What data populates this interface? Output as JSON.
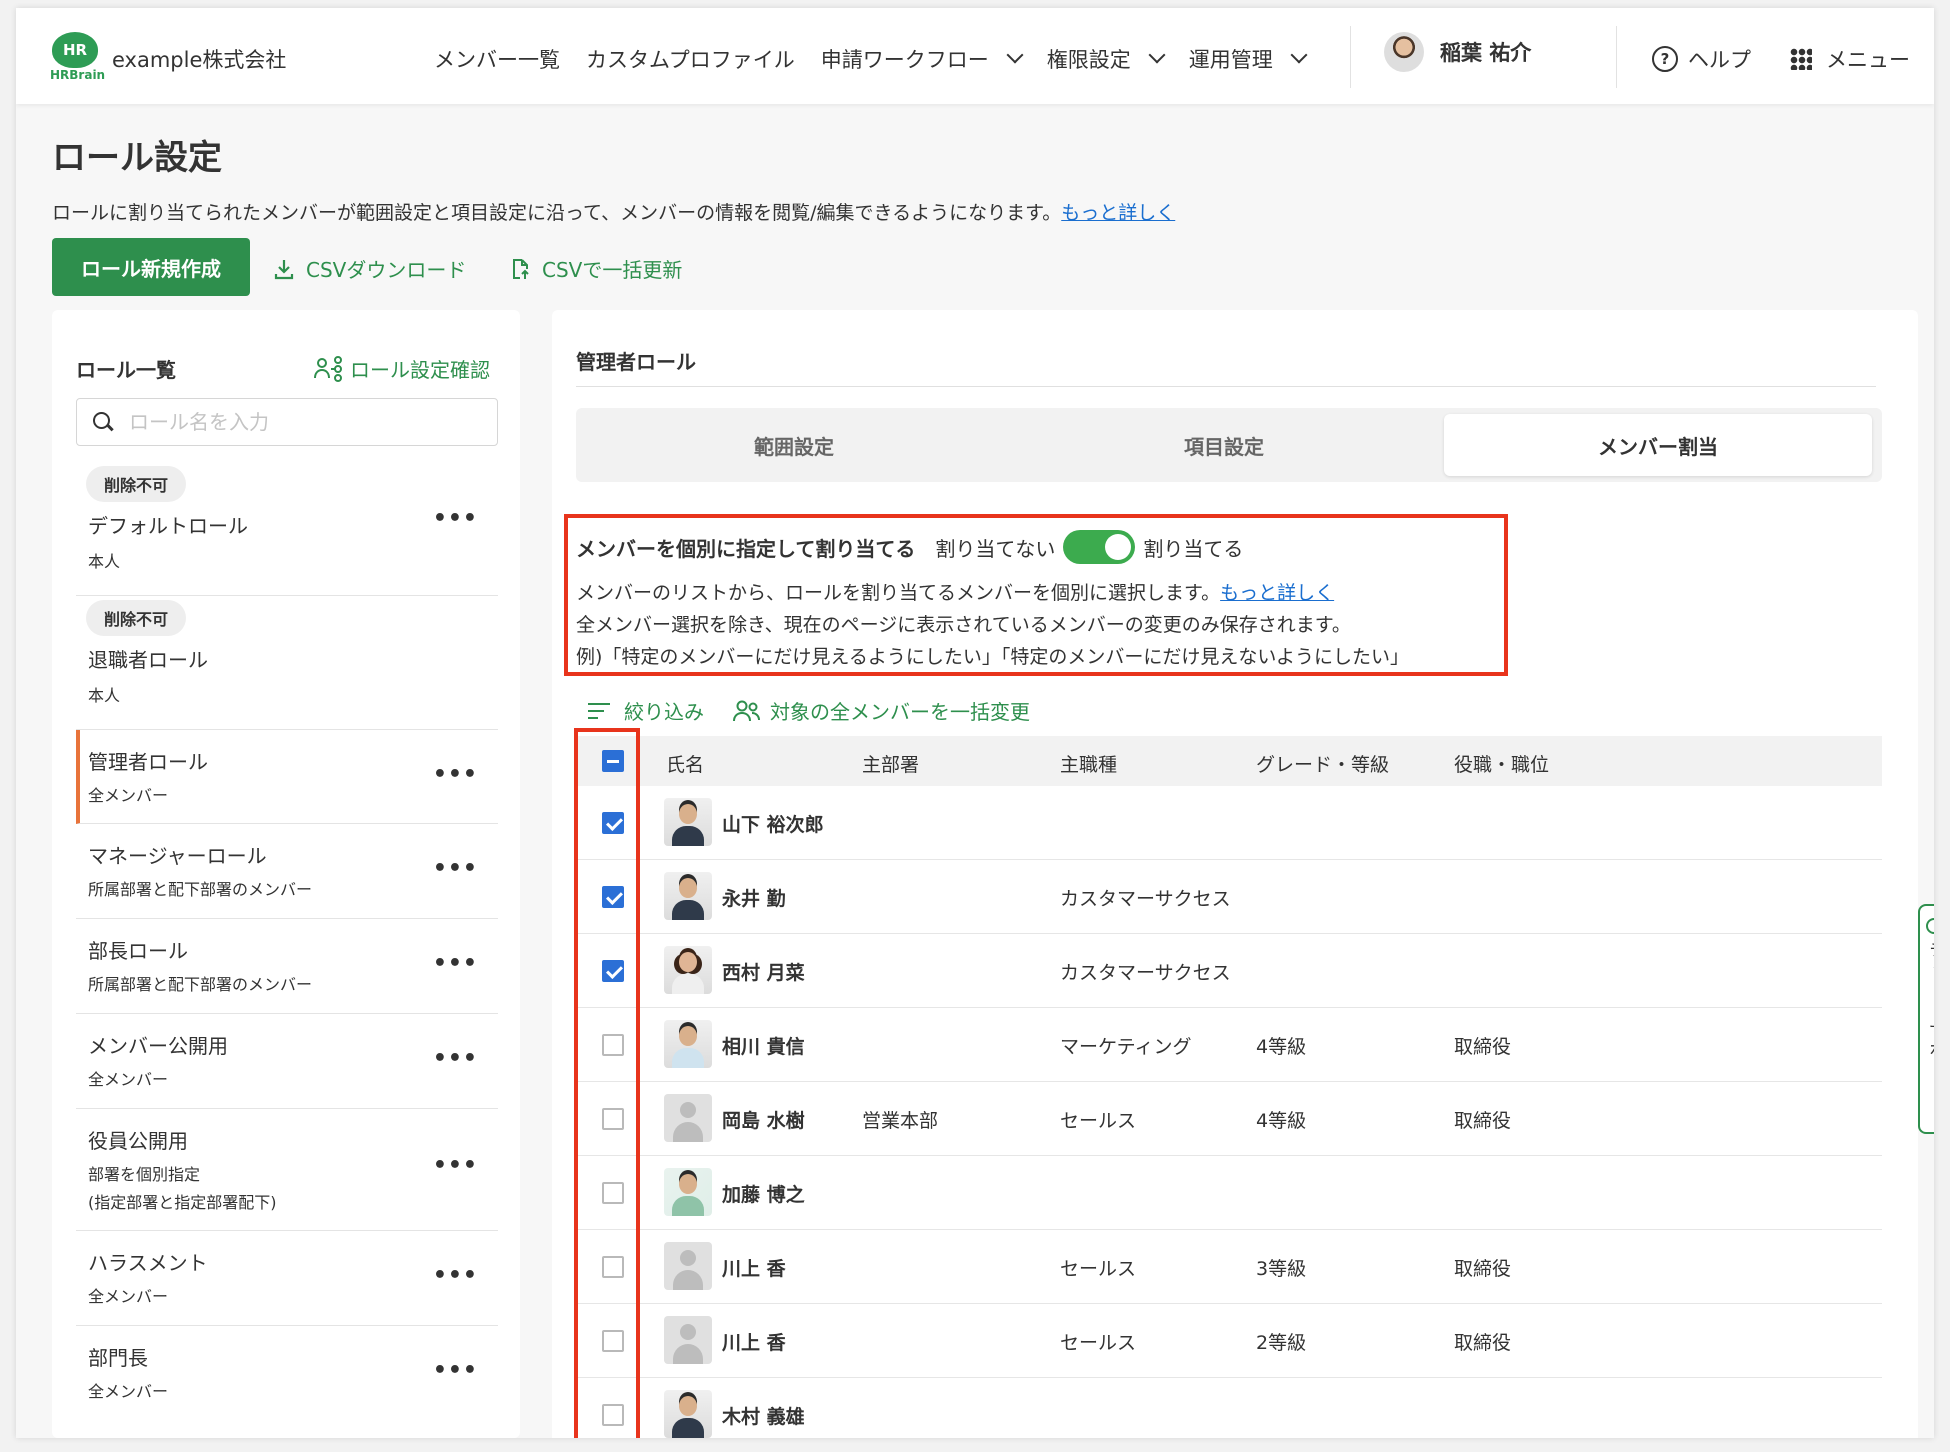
{
  "header": {
    "logo_text": "HR",
    "logo_sub": "HRBrain",
    "company": "example株式会社",
    "nav": [
      "メンバー一覧",
      "カスタムプロファイル",
      "申請ワークフロー",
      "権限設定",
      "運用管理"
    ],
    "user_name": "稲葉 祐介",
    "help_label": "ヘルプ",
    "menu_label": "メニュー"
  },
  "page": {
    "title": "ロール設定",
    "description": "ロールに割り当てられたメンバーが範囲設定と項目設定に沿って、メンバーの情報を閲覧/編集できるようになります。",
    "more_link": "もっと詳しく",
    "create_button": "ロール新規作成",
    "csv_download": "CSVダウンロード",
    "csv_update": "CSVで一括更新"
  },
  "role_list": {
    "title": "ロール一覧",
    "confirm_link": "ロール設定確認",
    "search_placeholder": "ロール名を入力",
    "roles": [
      {
        "badge": "削除不可",
        "name": "デフォルトロール",
        "scope": "本人"
      },
      {
        "badge": "削除不可",
        "name": "退職者ロール",
        "scope": "本人"
      },
      {
        "name": "管理者ロール",
        "scope": "全メンバー"
      },
      {
        "name": "マネージャーロール",
        "scope": "所属部署と配下部署のメンバー"
      },
      {
        "name": "部長ロール",
        "scope": "所属部署と配下部署のメンバー"
      },
      {
        "name": "メンバー公開用",
        "scope": "全メンバー"
      },
      {
        "name": "役員公開用",
        "scope": "部署を個別指定",
        "scope2": "(指定部署と指定部署配下)"
      },
      {
        "name": "ハラスメント",
        "scope": "全メンバー"
      },
      {
        "name": "部門長",
        "scope": "全メンバー"
      }
    ],
    "more_icon": "•••"
  },
  "detail": {
    "title": "管理者ロール",
    "tabs": [
      "範囲設定",
      "項目設定",
      "メンバー割当"
    ],
    "active_tab": "メンバー割当",
    "assign_label": "メンバーを個別に指定して割り当てる",
    "off_label": "割り当てない",
    "on_label": "割り当てる",
    "toggle_state": "on",
    "info_line1": "メンバーのリストから、ロールを割り当てるメンバーを個別に選択します。",
    "info_link": "もっと詳しく",
    "info_line2": "全メンバー選択を除き、現在のページに表示されているメンバーの変更のみ保存されます。",
    "info_line3": "例)「特定のメンバーにだけ見えるようにしたい」「特定のメンバーにだけ見えないようにしたい」",
    "filter_label": "絞り込み",
    "bulk_label": "対象の全メンバーを一括変更",
    "columns": [
      "氏名",
      "主部署",
      "主職種",
      "グレード・等級",
      "役職・職位"
    ],
    "members": [
      {
        "name": "山下 裕次郎",
        "dept": "",
        "job": "",
        "grade": "",
        "position": "",
        "checked": true,
        "avatar": "photo"
      },
      {
        "name": "永井 勤",
        "dept": "",
        "job": "カスタマーサクセス",
        "grade": "",
        "position": "",
        "checked": true,
        "avatar": "photo"
      },
      {
        "name": "西村 月菜",
        "dept": "",
        "job": "カスタマーサクセス",
        "grade": "",
        "position": "",
        "checked": true,
        "avatar": "photo woman"
      },
      {
        "name": "相川 貴信",
        "dept": "",
        "job": "マーケティング",
        "grade": "4等級",
        "position": "取締役",
        "checked": false,
        "avatar": "photo light"
      },
      {
        "name": "岡島 水樹",
        "dept": "営業本部",
        "job": "セールス",
        "grade": "4等級",
        "position": "取締役",
        "checked": false,
        "avatar": "placeholder"
      },
      {
        "name": "加藤 博之",
        "dept": "",
        "job": "",
        "grade": "",
        "position": "",
        "checked": false,
        "avatar": "photo illust"
      },
      {
        "name": "川上 香",
        "dept": "",
        "job": "セールス",
        "grade": "3等級",
        "position": "取締役",
        "checked": false,
        "avatar": "placeholder"
      },
      {
        "name": "川上 香",
        "dept": "",
        "job": "セールス",
        "grade": "2等級",
        "position": "取締役",
        "checked": false,
        "avatar": "placeholder"
      },
      {
        "name": "木村 義雄",
        "dept": "",
        "job": "",
        "grade": "",
        "position": "",
        "checked": false,
        "avatar": "photo"
      }
    ]
  },
  "chat_support": "チャットサポート",
  "colors": {
    "brand_green": "#2e8f4d",
    "toggle_green": "#3cab4e",
    "highlight_red": "#e8341c",
    "check_blue": "#2b6fd6",
    "active_role_accent": "#e8733a"
  }
}
